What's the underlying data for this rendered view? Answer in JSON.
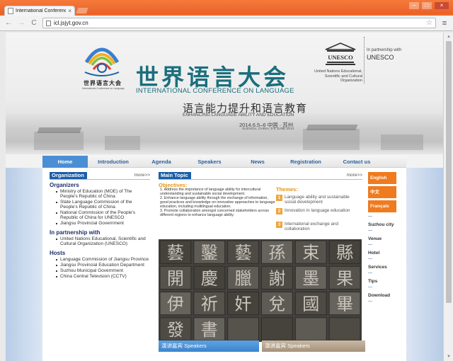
{
  "browser": {
    "tab_title": "International Conferenc",
    "tab_close": "×",
    "url": "icl.jsjyt.gov.cn",
    "back": "←",
    "forward": "→",
    "reload": "C",
    "star": "☆",
    "menu": "≡",
    "window_buttons": [
      "–",
      "□",
      "×"
    ]
  },
  "banner": {
    "logo_cn": "世界语言大会",
    "logo_en": "International Conference on Language",
    "title_cn": "世界语言大会",
    "title_en": "INTERNATIONAL CONFERENCE ON LANGUAGE",
    "subtitle_cn": "语言能力提升和语言教育",
    "subtitle_en": "ENHANCING LANGUAGE ABILITY AND EDUCATION",
    "date_cn": "2014.6.5–6 中国 · 苏州",
    "date_en": "SUZHOU, CHINA, 5-6 JUNE 2014",
    "unesco_acronym": "UNESCO",
    "unesco_text": "United Nations Educational, Scientific and Cultural Organization",
    "partner_label": "In partnership with",
    "partner_name": "UNESCO"
  },
  "nav": {
    "items": [
      "Home",
      "Introduction",
      "Agenda",
      "Speakers",
      "News",
      "Registration",
      "Contact us"
    ]
  },
  "organization": {
    "title": "Organization",
    "more": "more>>",
    "organizers_head": "Organizers",
    "organizers": [
      "Ministry of Education (MOE) of The People's Republic of China",
      "State Language Commission of the People's Republic of China",
      "National Commission of the People's Republic of China for UNESCO",
      "Jiangsu Provincial Government"
    ],
    "partnership_head": "In partnership with",
    "partnership": [
      "United Nations Educational, Scientific and Cultural Organization (UNESCO)"
    ],
    "hosts_head": "Hosts",
    "hosts": [
      "Language Commission of Jiangsu Province",
      "Jiangsu Provincial Education Department",
      "Suzhou Municipal Government",
      "China Central Television (CCTV)"
    ]
  },
  "main_topic": {
    "title": "Main Topic",
    "more": "more>>",
    "objectives_label": "Objectives:",
    "objectives": [
      "1. Address the importance of language ability for intercultural understanding and sustainable social development.",
      "2. Enhance language ability through the exchange of information, good practices and knowledge on innovative approaches to language education, including multilingual education.",
      "3. Promote collaboration amongst concerned stakeholders across different regions to enhance language ability."
    ],
    "themes_label": "Themes:",
    "themes": [
      {
        "num": "1",
        "text": "Language ability and sustainable social development"
      },
      {
        "num": "2",
        "text": "Innovation in language education"
      },
      {
        "num": "3",
        "text": "International exchange and collaboration"
      }
    ],
    "calligraphy_chars": [
      "藝",
      "鑿",
      "藝",
      "孫",
      "束",
      "縣",
      "開",
      "慶",
      "臘",
      "謝",
      "墨",
      "果",
      "伊",
      "祈",
      "奸",
      "兌",
      "國",
      "畢",
      "發",
      "書"
    ]
  },
  "speakers": {
    "left_label": "演讲嘉宾 Speakers",
    "right_label": "演讲嘉宾 Speakers"
  },
  "sidebar": {
    "languages": [
      "English",
      "中文",
      "Français"
    ],
    "links": [
      "Suzhou city",
      "Venue",
      "Hotel",
      "Services",
      "Tips",
      "Download"
    ],
    "dash": "—"
  },
  "colors": {
    "browser_frame": "#f06a2a",
    "nav_active": "#4a8fd4",
    "panel_title": "#1a5fa8",
    "accent_orange": "#e8910f",
    "lang_button": "#f07a1e",
    "title_teal": "#1a6f7d"
  }
}
